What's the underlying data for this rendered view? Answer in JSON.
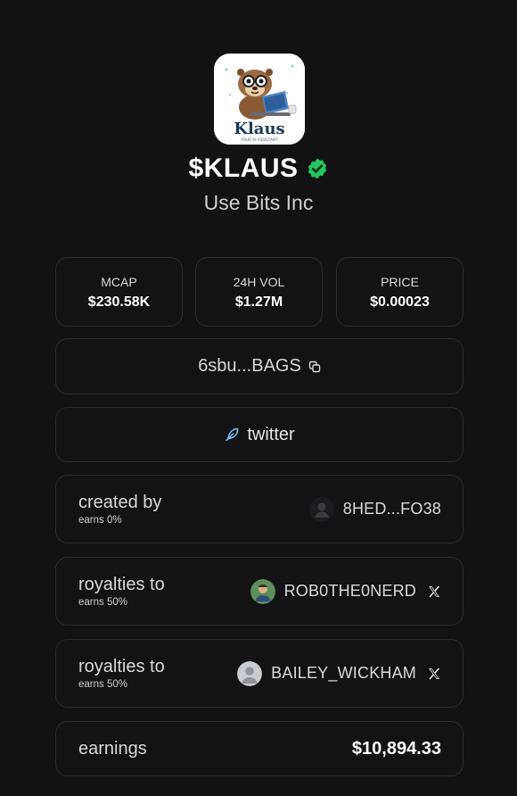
{
  "token": {
    "ticker": "$KLAUS",
    "company": "Use Bits Inc",
    "logo_text": "Klaus",
    "logo_subtext": "YOUR AI ASSISTANT",
    "verified_icon": "verified-check-icon",
    "verified_color": "#22c55e"
  },
  "stats": [
    {
      "label": "MCAP",
      "value": "$230.58K"
    },
    {
      "label": "24H VOL",
      "value": "$1.27M"
    },
    {
      "label": "PRICE",
      "value": "$0.00023"
    }
  ],
  "contract": {
    "address": "6sbu...BAGS",
    "icon": "copy-icon"
  },
  "twitter": {
    "label": "twitter",
    "icon": "feather-icon",
    "icon_color": "#7cc4f5"
  },
  "creator": {
    "label": "created by",
    "earns": "earns 0%",
    "user": "8HED...FO38"
  },
  "royalties": [
    {
      "label": "royalties to",
      "earns": "earns 50%",
      "user": "ROB0THE0NERD",
      "icon": "x-icon"
    },
    {
      "label": "royalties to",
      "earns": "earns 50%",
      "user": "BAILEY_WICKHAM",
      "icon": "x-icon"
    }
  ],
  "earnings": {
    "label": "earnings",
    "value": "$10,894.33"
  },
  "colors": {
    "background": "#121214",
    "card_border": "#2b2b30",
    "text": "#d9d9de"
  }
}
